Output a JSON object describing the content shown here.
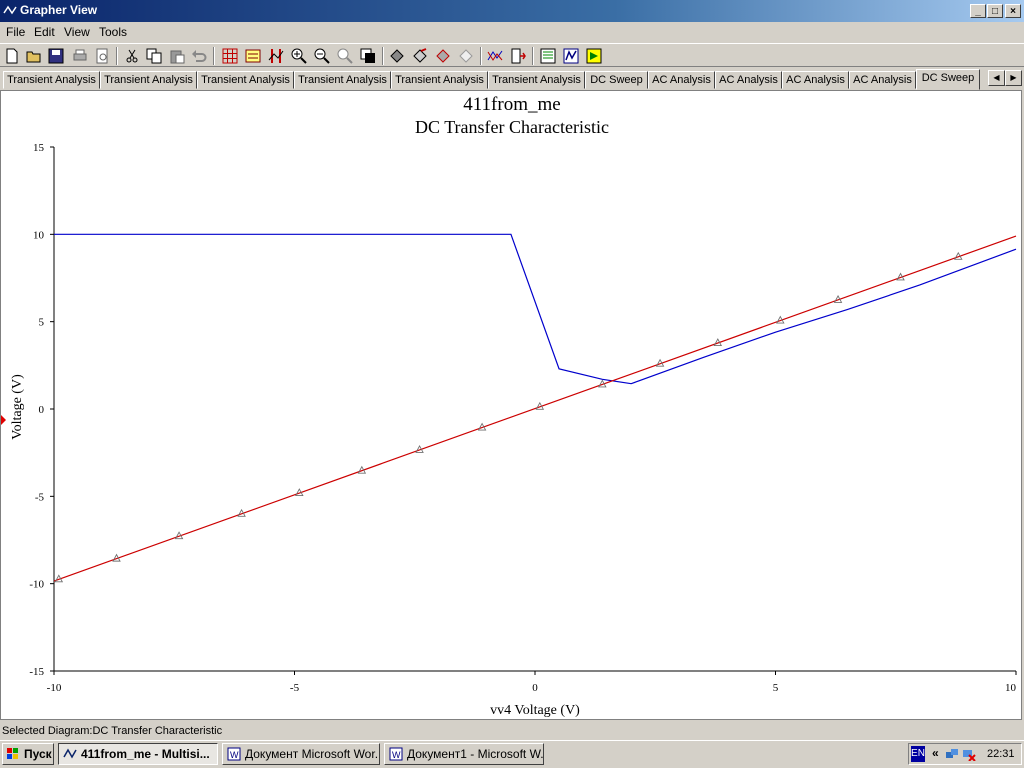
{
  "window": {
    "title": "Grapher View",
    "minimize": "_",
    "maximize": "□",
    "close": "×"
  },
  "menu": [
    "File",
    "Edit",
    "View",
    "Tools"
  ],
  "toolbar_icons": [
    "new-icon",
    "open-icon",
    "save-icon",
    "print-icon",
    "print-preview-icon",
    "cut-icon",
    "copy-icon",
    "paste-icon",
    "undo-icon",
    "grid-icon",
    "legend-icon",
    "cursors-icon",
    "zoom-in-icon",
    "zoom-out-icon",
    "zoom-full-icon",
    "reverse-colors-icon",
    "add-trace-icon",
    "select-marks-icon",
    "invert-icon",
    "overlay-traces-icon",
    "export-excel-icon",
    "export-measurements-icon",
    "export-mathcad-icon",
    "export-lvm-icon"
  ],
  "tabs": [
    "Transient Analysis",
    "Transient Analysis",
    "Transient Analysis",
    "Transient Analysis",
    "Transient Analysis",
    "Transient Analysis",
    "DC Sweep",
    "AC Analysis",
    "AC Analysis",
    "AC Analysis",
    "AC Analysis",
    "DC Sweep"
  ],
  "active_tab_index": 11,
  "tab_scroll": {
    "left": "◀",
    "right": "▶"
  },
  "chart_data": {
    "type": "line",
    "title": "411from_me",
    "subtitle": "DC Transfer Characteristic",
    "xlabel": "vv4 Voltage (V)",
    "ylabel": "Voltage (V)",
    "xlim": [
      -10,
      10
    ],
    "ylim": [
      -15,
      15
    ],
    "xticks": [
      -10,
      -5,
      0,
      5,
      10
    ],
    "yticks": [
      -15,
      -10,
      -5,
      0,
      5,
      10,
      15
    ],
    "xtick_labels": [
      "-10",
      "-5",
      "0",
      "5",
      "10"
    ],
    "ytick_labels": [
      "-15",
      "-10",
      "-5",
      "0",
      "5",
      "10",
      "15"
    ],
    "grid": false,
    "series": [
      {
        "color": "#0000cc",
        "marker": "none",
        "x": [
          -10,
          -0.5,
          0.5,
          1.4,
          2.0,
          3.5,
          5.0,
          6.5,
          8.0,
          10.0
        ],
        "y": [
          10,
          10,
          2.3,
          1.7,
          1.45,
          2.95,
          4.4,
          5.7,
          7.1,
          9.15
        ]
      },
      {
        "color": "#cc0000",
        "marker": "triangle",
        "x": [
          -10,
          10
        ],
        "y": [
          -9.85,
          9.9
        ],
        "marker_x": [
          -9.9,
          -8.7,
          -7.4,
          -6.1,
          -4.9,
          -3.6,
          -2.4,
          -1.1,
          0.1,
          1.4,
          2.6,
          3.8,
          5.1,
          6.3,
          7.6,
          8.8
        ]
      }
    ]
  },
  "status": "Selected Diagram:DC Transfer Characteristic",
  "taskbar": {
    "start": "Пуск",
    "tasks": [
      {
        "label": "411from_me - Multisi...",
        "active": true
      },
      {
        "label": "Документ Microsoft Wor...",
        "active": false
      },
      {
        "label": "Документ1 - Microsoft W...",
        "active": false
      }
    ],
    "lang": "EN",
    "chevron": "«",
    "clock": "22:31"
  }
}
